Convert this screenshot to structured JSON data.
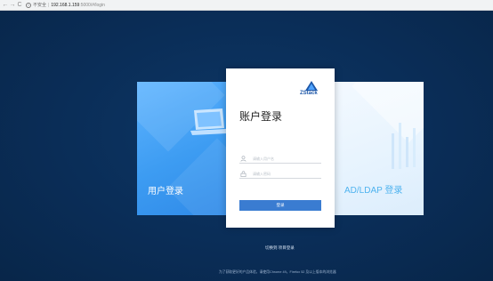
{
  "browser": {
    "back_icon": "←",
    "forward_icon": "→",
    "reload_icon": "C",
    "secure_icon": "i",
    "secure_label": "不安全",
    "separator": "|",
    "url_host": "192.168.1.159",
    "url_path": ":5000/#/login"
  },
  "cards": {
    "user_login_label": "用户登录",
    "ldap_login_label": "AD/LDAP 登录"
  },
  "login": {
    "logo_text": "ZStack",
    "title": "账户登录",
    "username_placeholder": "请输入用户名",
    "password_placeholder": "请输入密码",
    "submit_label": "登录"
  },
  "switch_link": "切换到 项目登录",
  "footer_note": "为了获取更好的产品体验，请使用Chrome 49，Firefox 52 及以上版本的浏览器",
  "colors": {
    "background": "#0b2d55",
    "accent": "#3a7cd1",
    "user_card": "#3d9cf2",
    "ldap_label": "#4fb3ef"
  }
}
